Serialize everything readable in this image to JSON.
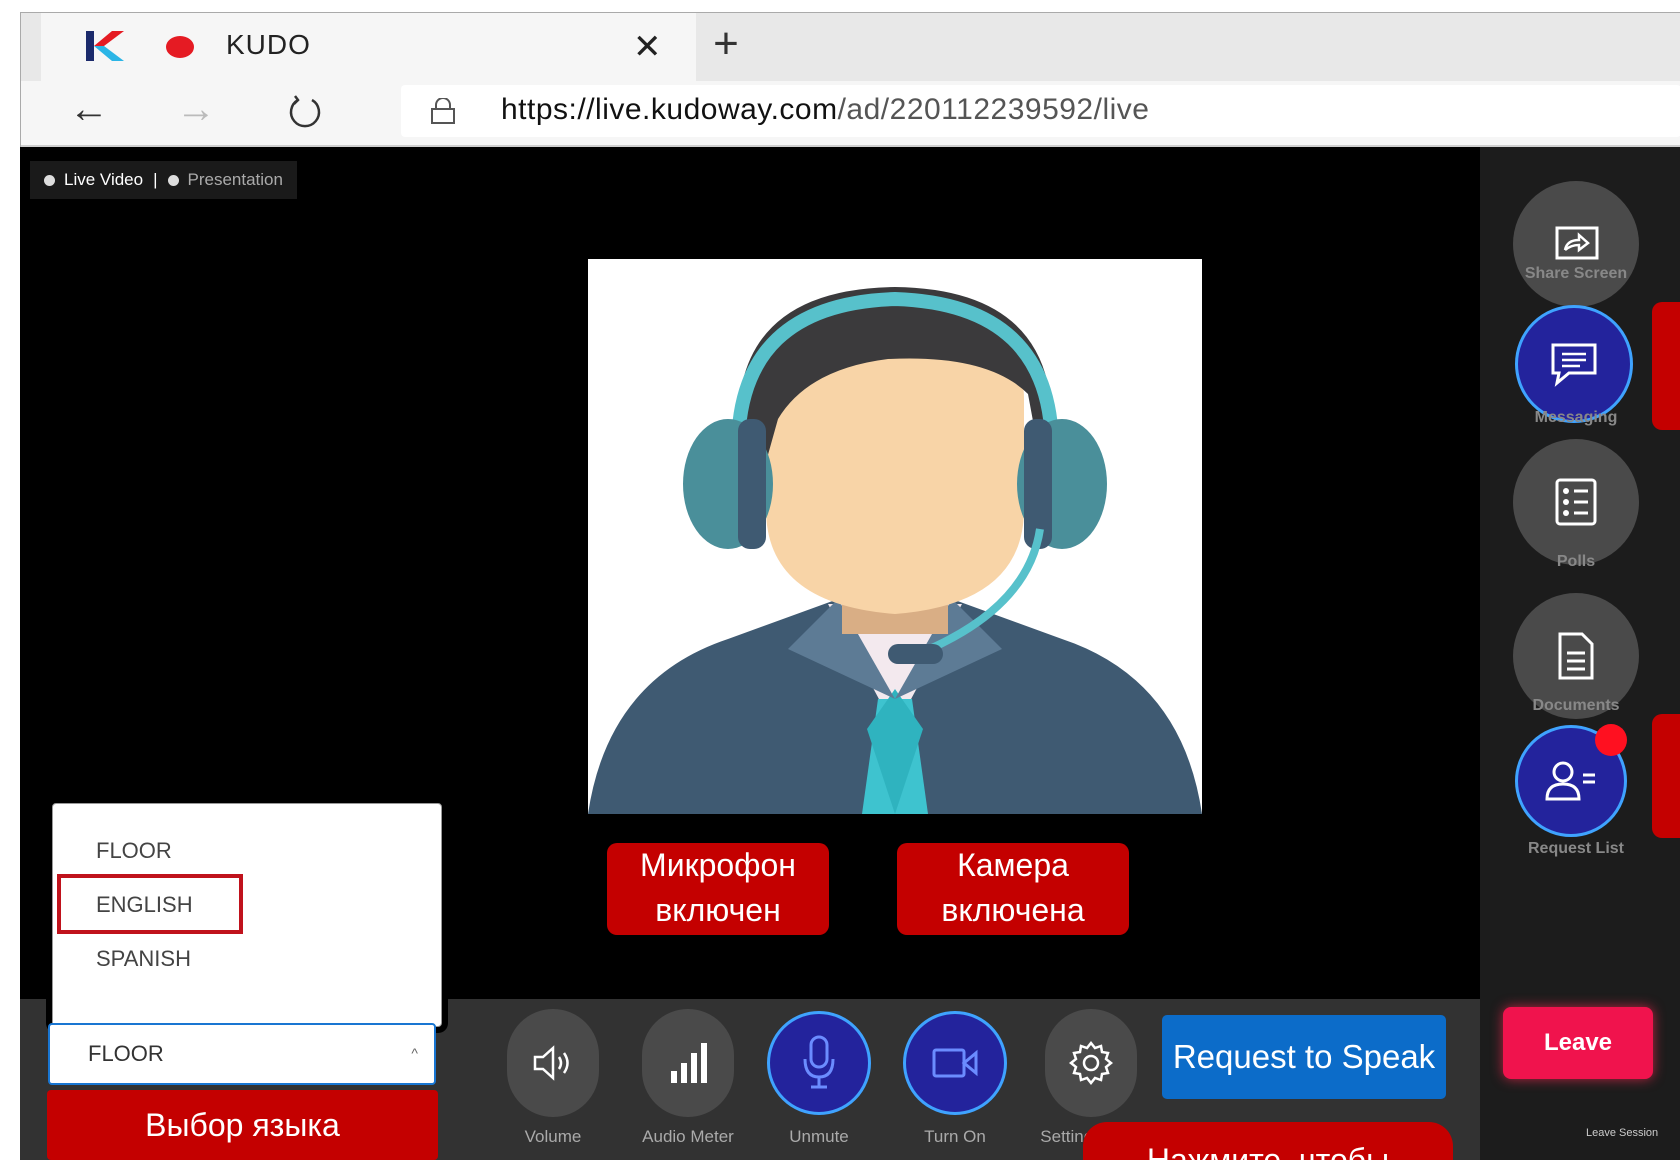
{
  "browser": {
    "tab_title": "KUDO",
    "url_domain": "https://live.kudoway.com",
    "url_path": "/ad/220112239592/live"
  },
  "app": {
    "mode_toggle": {
      "live_video": "Live Video",
      "separator": "|",
      "presentation": "Presentation"
    },
    "sidebar": {
      "share_screen": "Share Screen",
      "messaging": "Messaging",
      "polls": "Polls",
      "documents": "Documents",
      "request_list": "Request List",
      "leave": "Leave",
      "leave_session": "Leave Session"
    },
    "controls": {
      "volume": "Volume",
      "audio_meter": "Audio Meter",
      "unmute": "Unmute",
      "turn_on": "Turn On",
      "settings": "Settings",
      "request_to_speak": "Request to Speak"
    },
    "language": {
      "options": [
        "FLOOR",
        "ENGLISH",
        "SPANISH"
      ],
      "selected": "FLOOR",
      "highlighted": "ENGLISH"
    }
  },
  "annotations": {
    "mic": "Микрофон включен",
    "camera": "Камера включена",
    "language": "Выбор языка",
    "click_to": "Нажмите, чтобы"
  },
  "colors": {
    "accent_blue": "#0c6cc9",
    "active_button": "#23239c",
    "leave_red": "#f0134d",
    "annotation_red": "#c40000"
  }
}
